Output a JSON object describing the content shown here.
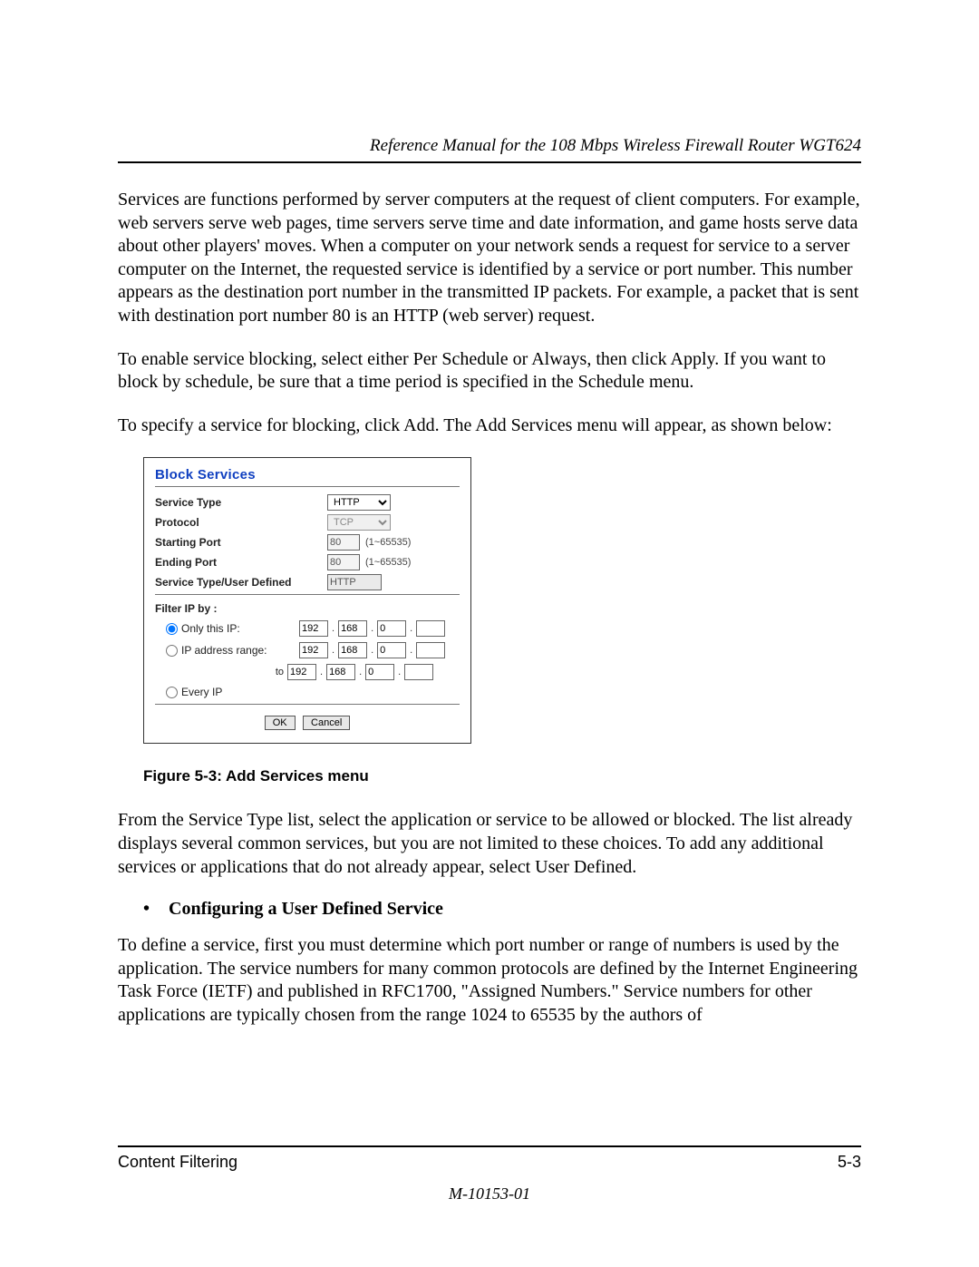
{
  "header": {
    "running_title": "Reference Manual for the 108 Mbps Wireless Firewall Router WGT624"
  },
  "paragraphs": {
    "p1": "Services are functions performed by server computers at the request of client computers. For example, web servers serve web pages, time servers serve time and date information, and game hosts serve data about other players' moves. When a computer on your network sends a request for service to a server computer on the Internet, the requested service is identified by a service or port number. This number appears as the destination port number in the transmitted IP packets. For example, a packet that is sent with destination port number 80 is an HTTP (web server) request.",
    "p2": "To enable service blocking, select either Per Schedule or Always, then click Apply. If you want to block by schedule, be sure that a time period is specified in the Schedule menu.",
    "p3": "To specify a service for blocking, click Add. The Add Services menu will appear, as shown below:",
    "p4": "From the Service Type list, select the application or service to be allowed or blocked. The list already displays several common services, but you are not limited to these choices. To add any additional services or applications that do not already appear, select User Defined.",
    "p5": "To define a service, first you must determine which port number or range of numbers is used by the application. The service numbers for many common protocols are defined by the Internet Engineering Task Force (IETF) and published in RFC1700, \"Assigned Numbers.\" Service numbers for other applications are typically chosen from the range 1024 to 65535 by the authors of"
  },
  "screenshot": {
    "title": "Block Services",
    "rows": {
      "service_type_label": "Service Type",
      "service_type_value": "HTTP",
      "protocol_label": "Protocol",
      "protocol_value": "TCP",
      "starting_port_label": "Starting Port",
      "starting_port_value": "80",
      "starting_port_range": "(1~65535)",
      "ending_port_label": "Ending Port",
      "ending_port_value": "80",
      "ending_port_range": "(1~65535)",
      "user_defined_label": "Service Type/User Defined",
      "user_defined_value": "HTTP"
    },
    "filter": {
      "heading": "Filter IP by :",
      "only_this_ip": "Only this IP:",
      "ip_range": "IP address range:",
      "to_label": "to",
      "every_ip": "Every IP",
      "ip1": {
        "a": "192",
        "b": "168",
        "c": "0",
        "d": ""
      },
      "ip_from": {
        "a": "192",
        "b": "168",
        "c": "0",
        "d": ""
      },
      "ip_to": {
        "a": "192",
        "b": "168",
        "c": "0",
        "d": ""
      }
    },
    "buttons": {
      "ok": "OK",
      "cancel": "Cancel"
    }
  },
  "figure_caption": "Figure 5-3:  Add Services menu",
  "bullet": {
    "marker": "•",
    "text": "Configuring a User Defined Service"
  },
  "footer": {
    "left": "Content Filtering",
    "right": "5-3",
    "docnum": "M-10153-01"
  }
}
